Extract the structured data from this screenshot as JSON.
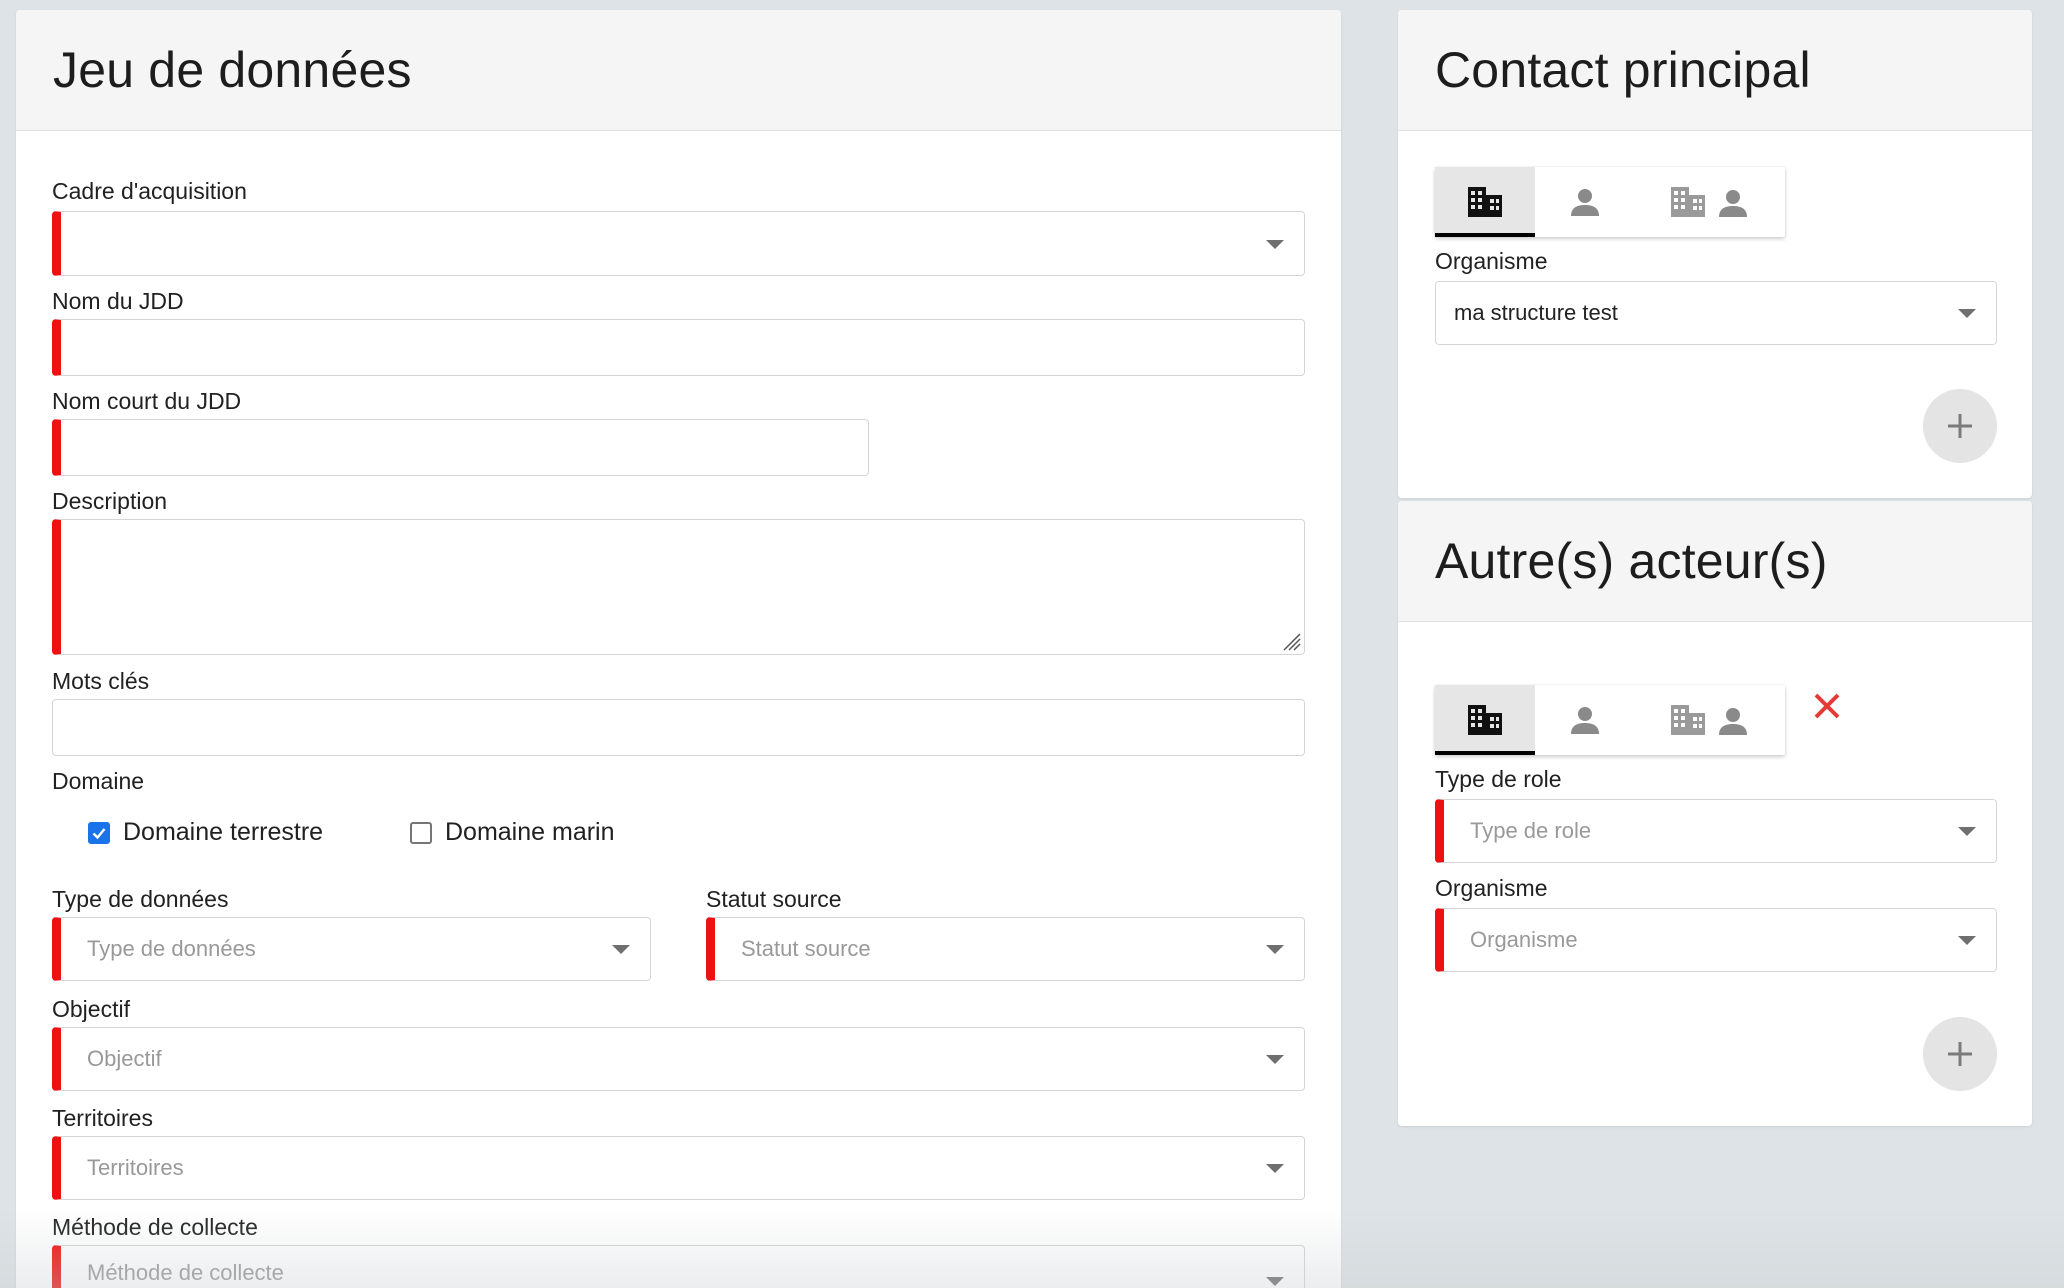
{
  "dataset": {
    "title": "Jeu de données",
    "acquisition": {
      "label": "Cadre d'acquisition",
      "value": ""
    },
    "name": {
      "label": "Nom du JDD",
      "value": ""
    },
    "short_name": {
      "label": "Nom court du JDD",
      "value": ""
    },
    "description": {
      "label": "Description",
      "value": ""
    },
    "keywords": {
      "label": "Mots clés",
      "value": ""
    },
    "domain": {
      "label": "Domaine",
      "options": [
        {
          "label": "Domaine terrestre",
          "checked": true
        },
        {
          "label": "Domaine marin",
          "checked": false
        }
      ]
    },
    "data_type": {
      "label": "Type de données",
      "placeholder": "Type de données"
    },
    "source_status": {
      "label": "Statut source",
      "placeholder": "Statut source"
    },
    "objective": {
      "label": "Objectif",
      "placeholder": "Objectif"
    },
    "territories": {
      "label": "Territoires",
      "placeholder": "Territoires"
    },
    "collect_method": {
      "label": "Méthode de collecte",
      "placeholder": "Méthode de collecte"
    }
  },
  "main_contact": {
    "title": "Contact principal",
    "organism": {
      "label": "Organisme",
      "value": "ma structure test"
    },
    "toggle_icons": [
      "organization-icon",
      "person-icon",
      "organization-person-icon"
    ]
  },
  "other_actors": {
    "title": "Autre(s) acteur(s)",
    "role_type": {
      "label": "Type de role",
      "placeholder": "Type de role"
    },
    "organism": {
      "label": "Organisme",
      "placeholder": "Organisme"
    },
    "toggle_icons": [
      "organization-icon",
      "person-icon",
      "organization-person-icon"
    ]
  },
  "colors": {
    "required_marker": "#ee1111",
    "checkbox_checked": "#1a73e8",
    "close_icon": "#e53935",
    "background": "#dde3e6"
  }
}
